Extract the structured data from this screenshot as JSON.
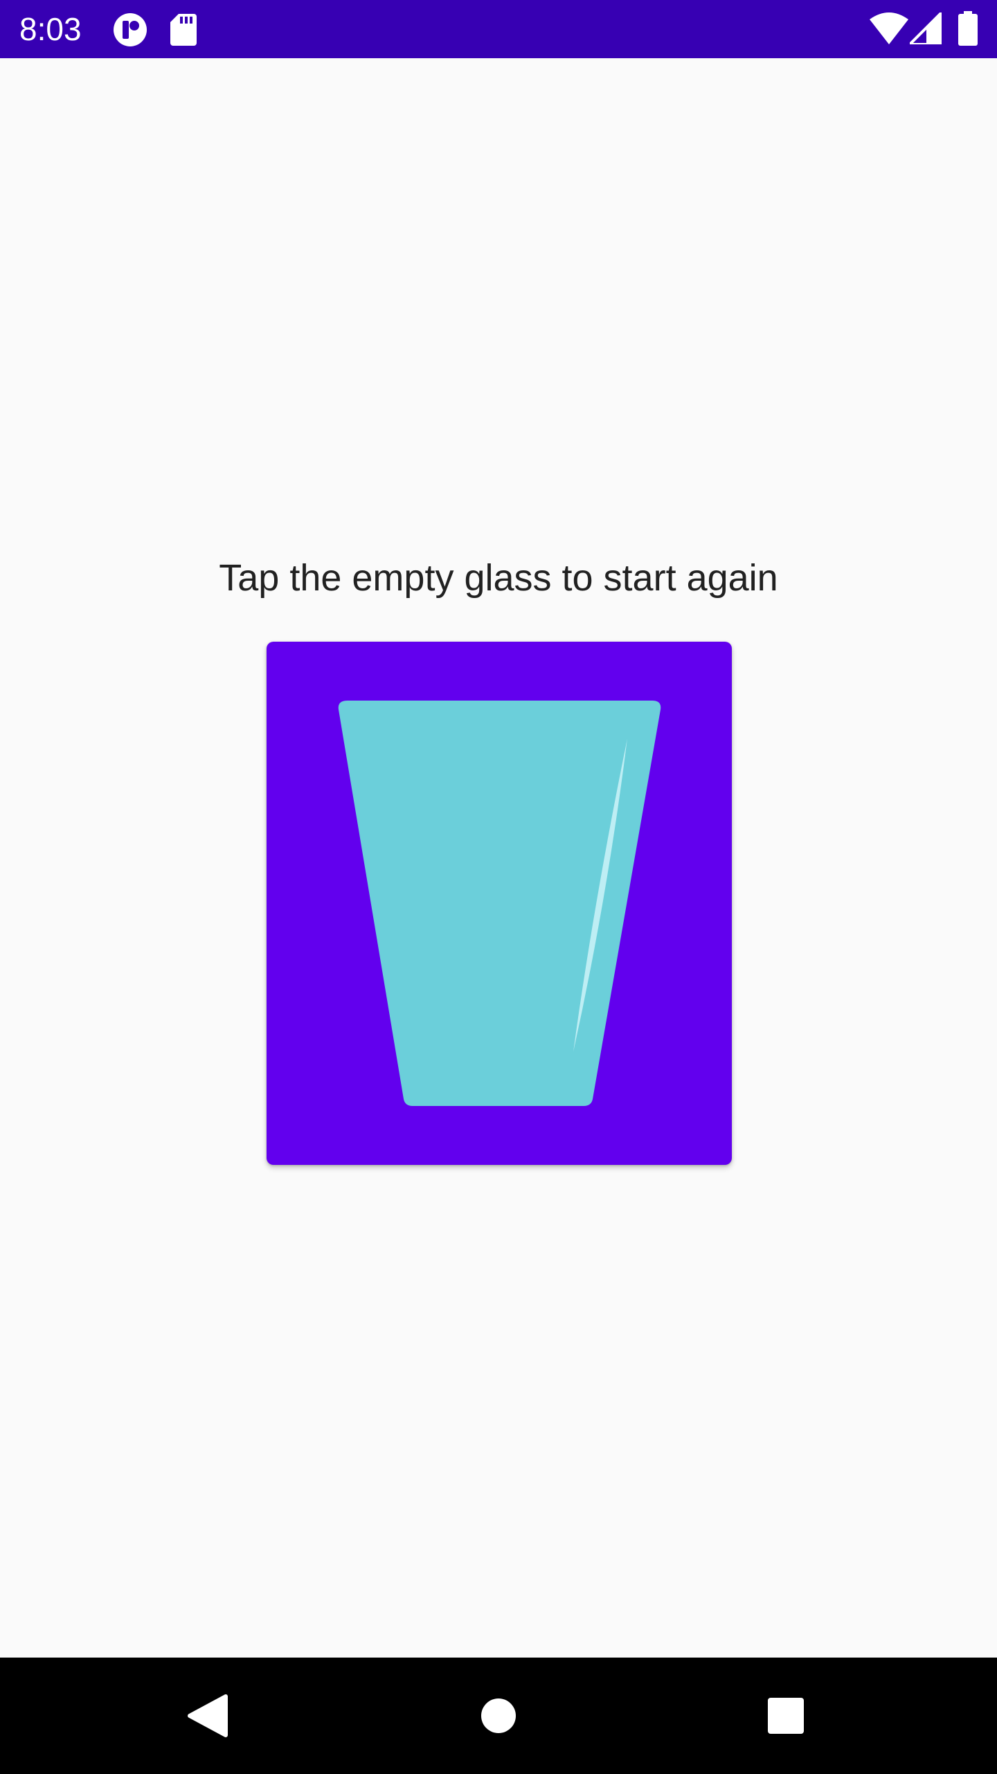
{
  "status_bar": {
    "time": "8:03",
    "background_color": "#3700b3",
    "icons": [
      "app-notification-icon",
      "sd-card-icon",
      "wifi-icon",
      "signal-icon",
      "battery-icon"
    ]
  },
  "main": {
    "prompt": "Tap the empty glass to start again",
    "glass_button": {
      "background_color": "#6200ee",
      "glass_color": "#6bcfda",
      "icon": "empty-glass-icon"
    }
  },
  "nav_bar": {
    "background_color": "#000000",
    "buttons": [
      "back-icon",
      "home-icon",
      "recents-icon"
    ]
  }
}
